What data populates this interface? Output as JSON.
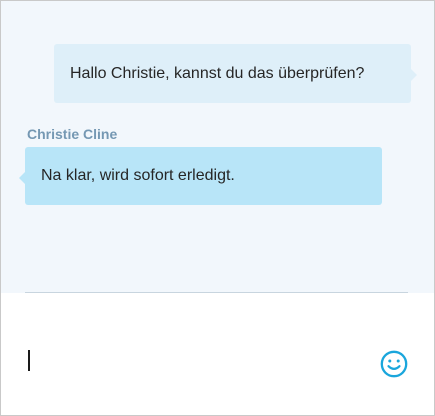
{
  "conversation": {
    "messages": [
      {
        "direction": "outgoing",
        "sender": "",
        "text": "Hallo Christie, kannst du das überprüfen?"
      },
      {
        "direction": "incoming",
        "sender": "Christie Cline",
        "text": "Na klar, wird sofort erledigt."
      }
    ]
  },
  "compose": {
    "value": "",
    "placeholder": "",
    "emoji_icon": "smiley-face-icon"
  },
  "colors": {
    "conversation_background": "#f2f7fc",
    "outgoing_bubble": "#deeff9",
    "incoming_bubble": "#b8e5f8",
    "sender_name": "#7598b3",
    "emoji_icon": "#1aa6dc"
  }
}
